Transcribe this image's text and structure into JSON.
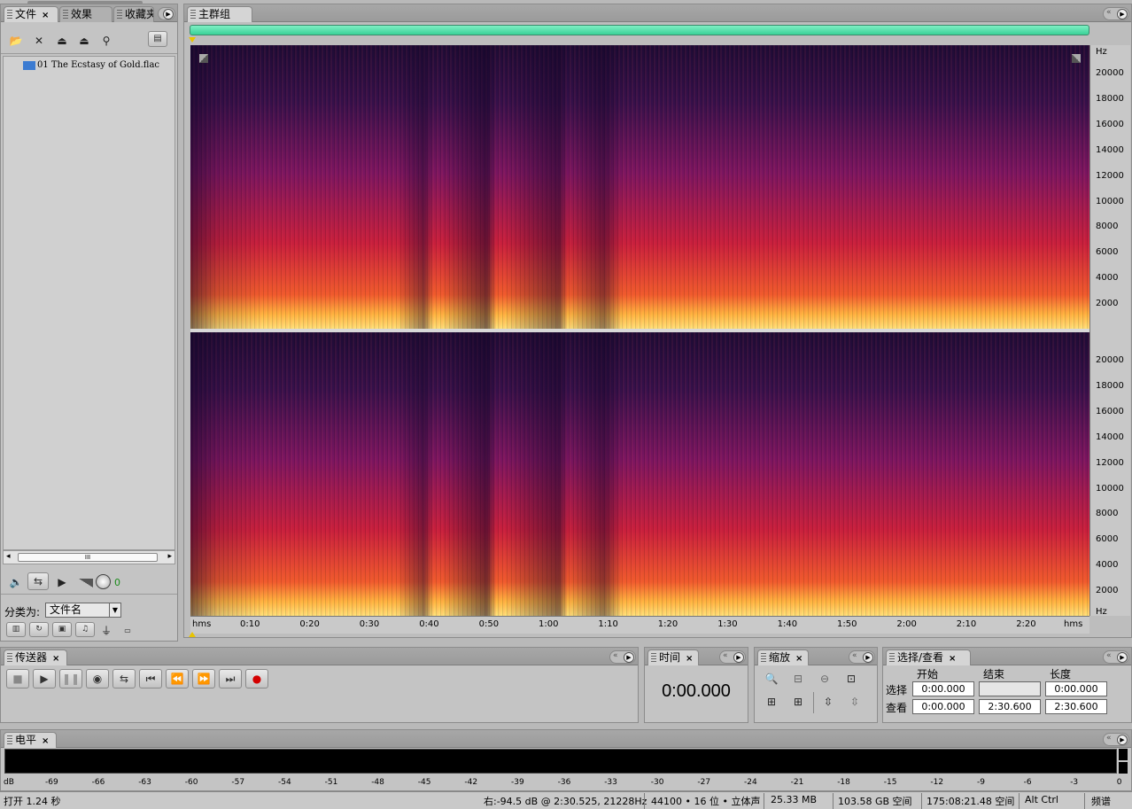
{
  "files_panel": {
    "tabs": [
      "文件",
      "效果",
      "收藏夹"
    ],
    "files": [
      "01 The Ecstasy of Gold.flac"
    ],
    "hscroll_label": "III",
    "volume_value": "0",
    "sort_label": "分类为:",
    "sort_value": "文件名"
  },
  "main_panel": {
    "tab": "主群组",
    "channel_axis_unit": "Hz",
    "freq_ticks_top": [
      "20000",
      "18000",
      "16000",
      "14000",
      "12000",
      "10000",
      "8000",
      "6000",
      "4000",
      "2000"
    ],
    "freq_ticks_bottom": [
      "20000",
      "18000",
      "16000",
      "14000",
      "12000",
      "10000",
      "8000",
      "6000",
      "4000",
      "2000"
    ],
    "bottom_axis_unit": "Hz",
    "time_ticks": [
      "0:10",
      "0:20",
      "0:30",
      "0:40",
      "0:50",
      "1:00",
      "1:10",
      "1:20",
      "1:30",
      "1:40",
      "1:50",
      "2:00",
      "2:10",
      "2:20"
    ],
    "time_unit": "hms"
  },
  "transport": {
    "tab": "传送器"
  },
  "time_panel": {
    "tab": "时间",
    "value": "0:00.000"
  },
  "zoom_panel": {
    "tab": "缩放"
  },
  "selection": {
    "tab": "选择/查看",
    "col_headers": [
      "开始",
      "结束",
      "长度"
    ],
    "rows": [
      {
        "label": "选择",
        "start": "0:00.000",
        "end": "",
        "length": "0:00.000"
      },
      {
        "label": "查看",
        "start": "0:00.000",
        "end": "2:30.600",
        "length": "2:30.600"
      }
    ]
  },
  "level_panel": {
    "tab": "电平",
    "scale": [
      "dB",
      "-69",
      "-66",
      "-63",
      "-60",
      "-57",
      "-54",
      "-51",
      "-48",
      "-45",
      "-42",
      "-39",
      "-36",
      "-33",
      "-30",
      "-27",
      "-24",
      "-21",
      "-18",
      "-15",
      "-12",
      "-9",
      "-6",
      "-3",
      "0"
    ]
  },
  "status": {
    "left": "打开 1.24 秒",
    "cursor": "右:-94.5 dB @  2:30.525, 21228Hz",
    "format": "44100 • 16 位 • 立体声",
    "size": "25.33 MB",
    "disk": "103.58 GB 空间",
    "time_free": "175:08:21.48 空间",
    "keys": "Alt Ctrl",
    "view": "频谱"
  },
  "colors": {
    "accent": "#4fdca0",
    "spec_dark": "#1b0b3a",
    "spec_mid": "#b21a4a",
    "spec_hot": "#ffd35a"
  }
}
